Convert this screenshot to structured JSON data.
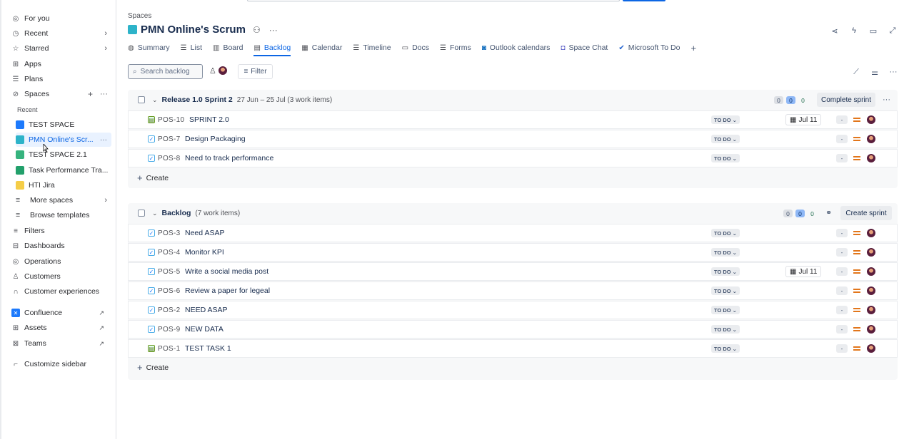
{
  "sidebar": {
    "items": [
      {
        "label": "For you",
        "icon": "person-circle-icon"
      },
      {
        "label": "Recent",
        "icon": "clock-icon"
      },
      {
        "label": "Starred",
        "icon": "star-icon"
      },
      {
        "label": "Apps",
        "icon": "apps-icon"
      },
      {
        "label": "Plans",
        "icon": "plans-icon"
      },
      {
        "label": "Spaces",
        "icon": "spaces-icon"
      }
    ],
    "recent_heading": "Recent",
    "spaces": [
      {
        "label": "TEST SPACE",
        "color": "#1d7afc"
      },
      {
        "label": "PMN Online's Scr...",
        "color": "#2db3c9"
      },
      {
        "label": "TEST SPACE 2.1",
        "color": "#36b37e"
      },
      {
        "label": "Task Performance Tra...",
        "color": "#22a06b"
      },
      {
        "label": "HTI Jira",
        "color": "#f5cd47"
      }
    ],
    "more_spaces": "More spaces",
    "browse_templates": "Browse templates",
    "bottom_items": [
      {
        "label": "Filters",
        "icon": "filter-icon"
      },
      {
        "label": "Dashboards",
        "icon": "dashboard-icon"
      },
      {
        "label": "Operations",
        "icon": "operations-icon"
      },
      {
        "label": "Customers",
        "icon": "customers-icon"
      },
      {
        "label": "Customer experiences",
        "icon": "headset-icon"
      }
    ],
    "apps": [
      {
        "label": "Confluence",
        "icon": "confluence-icon"
      },
      {
        "label": "Assets",
        "icon": "assets-icon"
      },
      {
        "label": "Teams",
        "icon": "teams-icon"
      }
    ],
    "customize": "Customize sidebar"
  },
  "header": {
    "breadcrumb": "Spaces",
    "title": "PMN Online's Scrum",
    "tabs": [
      {
        "label": "Summary",
        "icon": "globe-icon"
      },
      {
        "label": "List",
        "icon": "list-icon"
      },
      {
        "label": "Board",
        "icon": "board-icon"
      },
      {
        "label": "Backlog",
        "icon": "backlog-icon",
        "active": true
      },
      {
        "label": "Calendar",
        "icon": "calendar-icon"
      },
      {
        "label": "Timeline",
        "icon": "timeline-icon"
      },
      {
        "label": "Docs",
        "icon": "docs-icon"
      },
      {
        "label": "Forms",
        "icon": "forms-icon"
      },
      {
        "label": "Outlook calendars",
        "icon": "outlook-icon"
      },
      {
        "label": "Space Chat",
        "icon": "teams-chat-icon"
      },
      {
        "label": "Microsoft To Do",
        "icon": "todo-icon"
      }
    ]
  },
  "toolbar": {
    "search_placeholder": "Search backlog",
    "filter_label": "Filter"
  },
  "sprint": {
    "name": "Release 1.0 Sprint 2",
    "meta": "27 Jun – 25 Jul (3 work items)",
    "counts": [
      "0",
      "0",
      "0"
    ],
    "action": "Complete sprint",
    "create": "Create",
    "rows": [
      {
        "type": "story",
        "key": "POS-10",
        "summary": "SPRINT 2.0",
        "status": "TO DO",
        "date": "Jul 11",
        "estimate": "-"
      },
      {
        "type": "task",
        "key": "POS-7",
        "summary": "Design Packaging",
        "status": "TO DO",
        "date": "",
        "estimate": "-"
      },
      {
        "type": "task",
        "key": "POS-8",
        "summary": "Need to track performance",
        "status": "TO DO",
        "date": "",
        "estimate": "-"
      }
    ]
  },
  "backlog": {
    "name": "Backlog",
    "meta": "(7 work items)",
    "counts": [
      "0",
      "0",
      "0"
    ],
    "action": "Create sprint",
    "create": "Create",
    "rows": [
      {
        "type": "task",
        "key": "POS-3",
        "summary": "Need ASAP",
        "status": "TO DO",
        "date": "",
        "estimate": "-"
      },
      {
        "type": "task",
        "key": "POS-4",
        "summary": "Monitor KPI",
        "status": "TO DO",
        "date": "",
        "estimate": "-"
      },
      {
        "type": "task",
        "key": "POS-5",
        "summary": "Write a social media post",
        "status": "TO DO",
        "date": "Jul 11",
        "estimate": "-"
      },
      {
        "type": "task",
        "key": "POS-6",
        "summary": "Review a paper for legeal",
        "status": "TO DO",
        "date": "",
        "estimate": "-"
      },
      {
        "type": "task",
        "key": "POS-2",
        "summary": "NEED ASAP",
        "status": "TO DO",
        "date": "",
        "estimate": "-"
      },
      {
        "type": "task",
        "key": "POS-9",
        "summary": "NEW DATA",
        "status": "TO DO",
        "date": "",
        "estimate": "-"
      },
      {
        "type": "story",
        "key": "POS-1",
        "summary": "TEST TASK 1",
        "status": "TO DO",
        "date": "",
        "estimate": "-"
      }
    ]
  }
}
